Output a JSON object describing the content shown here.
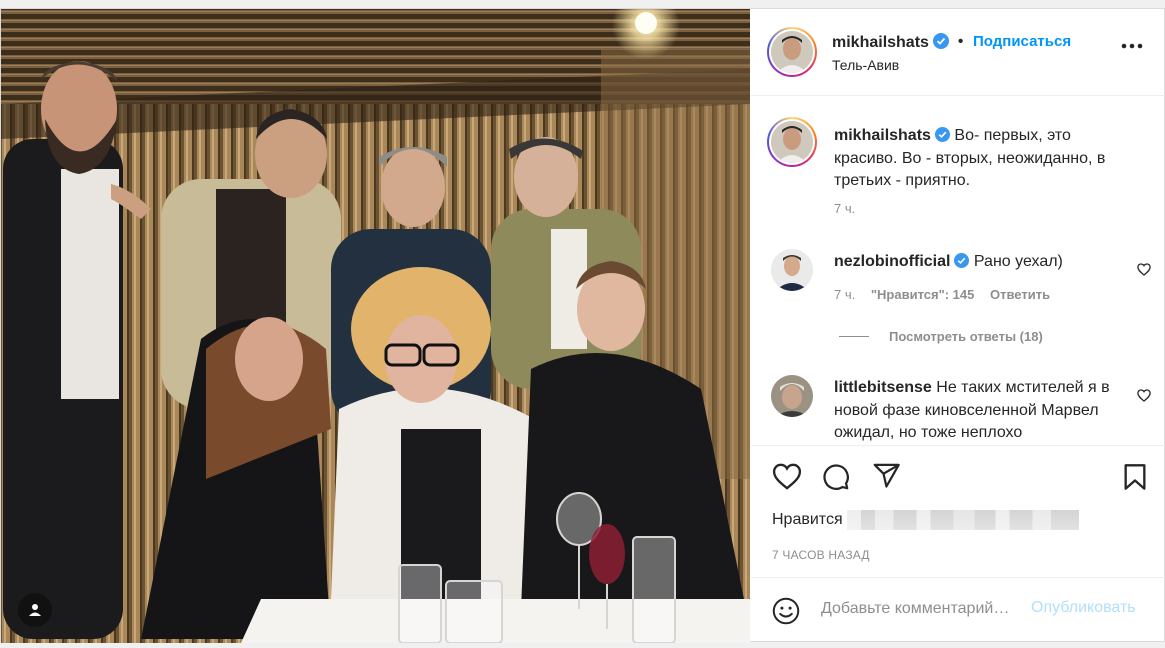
{
  "post": {
    "username": "mikhailshats",
    "verified": true,
    "dot": "•",
    "follow_label": "Подписаться",
    "location": "Тель-Авив",
    "more_icon": "more-horizontal-icon"
  },
  "caption": {
    "username": "mikhailshats",
    "text": "Во- первых, это красиво. Во - вторых, неожиданно, в третьих - приятно.",
    "time": "7 ч."
  },
  "comments": [
    {
      "username": "nezlobinofficial",
      "verified": true,
      "text": "Рано уехал)",
      "time": "7 ч.",
      "likes": "\"Нравится\": 145",
      "reply_label": "Ответить",
      "view_replies": "Посмотреть ответы (18)"
    },
    {
      "username": "littlebitsense",
      "verified": false,
      "text": "Не таких мстителей я в новой фазе киновселенной Марвел ожидал, но тоже неплохо"
    }
  ],
  "actions": {
    "like_icon": "heart-icon",
    "comment_icon": "comment-icon",
    "share_icon": "share-icon",
    "save_icon": "bookmark-icon",
    "likes_prefix": "Нравится",
    "timestamp": "7 ЧАСОВ НАЗАД"
  },
  "add_comment": {
    "emoji_icon": "emoji-icon",
    "placeholder": "Добавьте комментарий…",
    "publish_label": "Опубликовать"
  },
  "colors": {
    "link_blue": "#0095f6",
    "publish_disabled": "#b2dffc",
    "muted": "#8e8e8e",
    "verified_blue": "#3897f0"
  }
}
